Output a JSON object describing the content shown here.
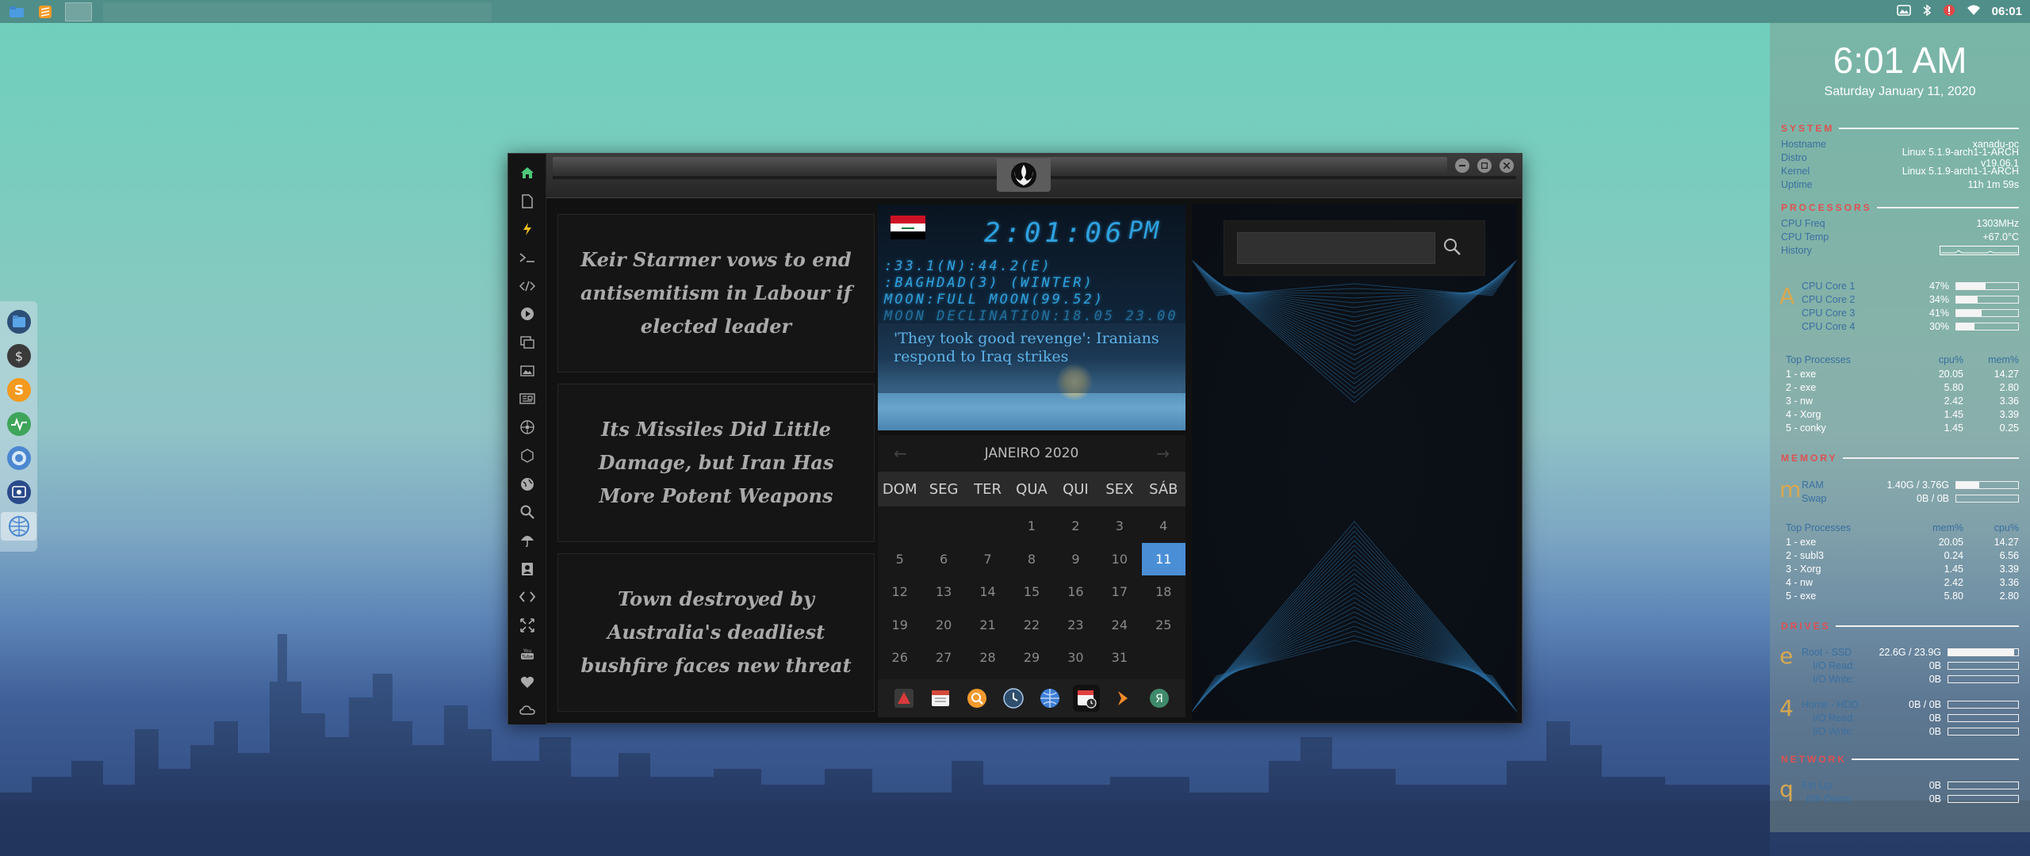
{
  "top_panel": {
    "clock": "06:01",
    "launchers": [
      "file-manager-icon",
      "sublime-text-icon"
    ],
    "tray": [
      "image-viewer-icon",
      "bluetooth-icon",
      "alert-icon",
      "wifi-icon"
    ]
  },
  "dock": {
    "items": [
      "file-manager-icon",
      "money-icon",
      "sublime-icon",
      "system-monitor-icon",
      "chromium-icon",
      "screenshot-icon",
      "network-icon"
    ]
  },
  "window": {
    "sidebar": [
      "home-icon",
      "document-icon",
      "bolt-icon",
      "terminal-icon",
      "code-icon",
      "play-icon",
      "gallery-icon",
      "image-icon",
      "news-icon",
      "flower-icon",
      "hexagon-icon",
      "globe-icon",
      "search-icon",
      "umbrella-icon",
      "contact-icon",
      "swap-icon",
      "expand-icon",
      "youtube-icon",
      "heart-icon",
      "cloud-icon"
    ],
    "news": [
      "Keir Starmer vows to end antisemitism in Labour if elected leader",
      "Its Missiles Did Little Damage, but Iran Has More Potent Weapons",
      "Town destroyed by Australia's deadliest bushfire faces new threat"
    ],
    "clock_widget": {
      "time": "2:01:06",
      "ampm": "PM",
      "lines": [
        ":33.1(N):44.2(E)",
        ":BAGHDAD(3) (WINTER)",
        "MOON:FULL MOON(99.52)",
        "MOON DECLINATION:18.05 23.00"
      ],
      "headline": "'They took good revenge': Iranians respond to Iraq strikes",
      "flag_colors": [
        "#ce1126",
        "#ffffff",
        "#000000"
      ]
    },
    "calendar": {
      "month_label": "JANEIRO 2020",
      "prev": "←",
      "next": "→",
      "weekdays": [
        "DOM",
        "SEG",
        "TER",
        "QUA",
        "QUI",
        "SEX",
        "SÁB"
      ],
      "today": "11"
    },
    "apps": [
      "pdf-icon",
      "calendar-app-icon",
      "search-app-icon",
      "clock-app-icon",
      "web-icon",
      "calendar-icon",
      "arrow-icon",
      "browser-icon"
    ],
    "search": {
      "placeholder": ""
    }
  },
  "conky": {
    "time": "6:01 AM",
    "date": "Saturday January 11, 2020",
    "system": {
      "title": "SYSTEM",
      "rows": [
        {
          "k": "Hostname",
          "v": "xanadu-pc"
        },
        {
          "k": "Distro",
          "v": "Linux 5.1.9-arch1-1-ARCH v19.06.1"
        },
        {
          "k": "Kernel",
          "v": "Linux 5.1.9-arch1-1-ARCH"
        },
        {
          "k": "Uptime",
          "v": "11h 1m 59s"
        }
      ]
    },
    "processors": {
      "title": "PROCESSORS",
      "freq_label": "CPU Freq",
      "freq": "1303MHz",
      "temp_label": "CPU Temp",
      "temp": "+67.0°C",
      "history_label": "History",
      "letter": "A",
      "cores": [
        {
          "k": "CPU Core 1",
          "v": "47%",
          "pct": 47
        },
        {
          "k": "CPU Core 2",
          "v": "34%",
          "pct": 34
        },
        {
          "k": "CPU Core 3",
          "v": "41%",
          "pct": 41
        },
        {
          "k": "CPU Core 4",
          "v": "30%",
          "pct": 30
        }
      ],
      "top_header": [
        "Top Processes",
        "cpu%",
        "mem%"
      ],
      "top": [
        {
          "n": "1 - exe",
          "a": "20.05",
          "b": "14.27"
        },
        {
          "n": "2 - exe",
          "a": "5.80",
          "b": "2.80"
        },
        {
          "n": "3 - nw",
          "a": "2.42",
          "b": "3.36"
        },
        {
          "n": "4 - Xorg",
          "a": "1.45",
          "b": "3.39"
        },
        {
          "n": "5 - conky",
          "a": "1.45",
          "b": "0.25"
        }
      ]
    },
    "memory": {
      "title": "MEMORY",
      "letter": "m",
      "ram_label": "RAM",
      "ram": "1.40G / 3.76G",
      "ram_pct": 37,
      "swap_label": "Swap",
      "swap": "0B / 0B",
      "swap_pct": 0,
      "top_header": [
        "Top Processes",
        "mem%",
        "cpu%"
      ],
      "top": [
        {
          "n": "1 - exe",
          "a": "20.05",
          "b": "14.27"
        },
        {
          "n": "2 - subl3",
          "a": "0.24",
          "b": "6.56"
        },
        {
          "n": "3 - Xorg",
          "a": "1.45",
          "b": "3.39"
        },
        {
          "n": "4 - nw",
          "a": "2.42",
          "b": "3.36"
        },
        {
          "n": "5 - exe",
          "a": "5.80",
          "b": "2.80"
        }
      ]
    },
    "drives": {
      "title": "DRIVES",
      "letter1": "e",
      "root_label": "Root - SSD",
      "root": "22.6G / 23.9G",
      "root_pct": 94,
      "io_read_label": "I/O Read:",
      "io_read": "0B",
      "io_write_label": "I/O Write:",
      "io_write": "0B",
      "letter2": "4",
      "home_label": "Home - HDD",
      "home": "0B / 0B",
      "home_pct": 0,
      "io2_read_label": "I/O Read:",
      "io2_read": "0B",
      "io2_write_label": "I/O Write:",
      "io2_write": "0B"
    },
    "network": {
      "title": "NETWORK",
      "letter": "q",
      "up_label": "Eth Up:",
      "up": "0B",
      "down_label": "Eth Down:",
      "down": "0B"
    }
  }
}
